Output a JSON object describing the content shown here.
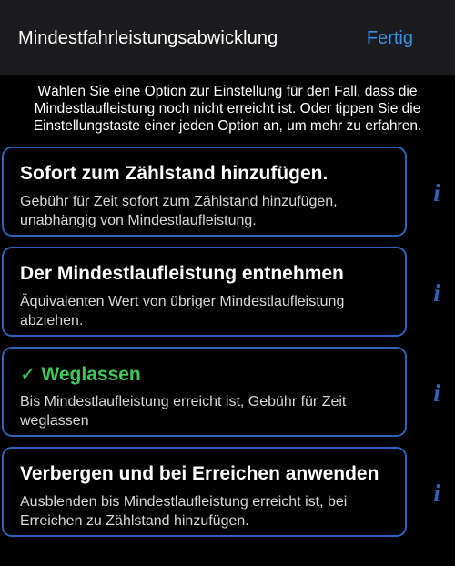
{
  "header": {
    "title": "Mindestfahrleistungsabwicklung",
    "done_label": "Fertig"
  },
  "intro": "Wählen Sie eine Option zur Einstellung  für den Fall, dass die Mindestlaufleistung noch nicht erreicht ist. Oder tippen Sie die Einstellungstaste einer jeden Option an, um mehr zu erfahren.",
  "options": [
    {
      "title": "Sofort zum Zählstand hinzufügen.",
      "description": "Gebühr für Zeit sofort zum Zählstand hinzufügen, unabhängig von Mindestlaufleistung.",
      "selected": false
    },
    {
      "title": "Der Mindestlaufleistung entnehmen",
      "description": "Äquivalenten Wert von übriger Mindestlaufleistung abziehen.",
      "selected": false
    },
    {
      "title": "✓ Weglassen",
      "description": "Bis Mindestlaufleistung erreicht ist, Gebühr für Zeit weglassen",
      "selected": true
    },
    {
      "title": "Verbergen und bei Erreichen anwenden",
      "description": "Ausblenden bis Mindestlaufleistung erreicht ist, bei Erreichen zu Zählstand hinzufügen.",
      "selected": false
    }
  ],
  "info_icon_glyph": "i",
  "colors": {
    "background": "#000000",
    "header_background": "#1c1c1e",
    "accent_blue": "#3a8ee6",
    "border_blue": "#2f63b8",
    "selected_green": "#3ec95b"
  }
}
